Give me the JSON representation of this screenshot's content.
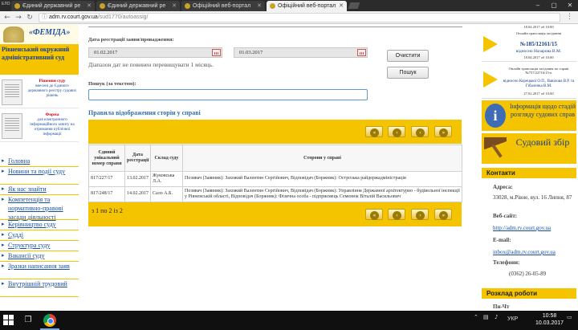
{
  "browser": {
    "profile_label": "ЕЛО",
    "tabs": [
      {
        "title": "Єдиний державний ре"
      },
      {
        "title": "Єдиний державний ре"
      },
      {
        "title": "Офіційний веб-портал"
      },
      {
        "title": "Офіційний веб-портал"
      }
    ],
    "url_host": "adm.rv.court.gov.ua",
    "url_path": "/sud1770/autoassig/"
  },
  "left": {
    "logo_text": "«ФЕМІДА»",
    "court_name": "Рівненський окружний адміністративний суд",
    "promo1_bold": "Рішення суду",
    "promo1_text": "внесені до Єдиного державного реєстру судових рішень",
    "promo2_bold": "Форма",
    "promo2_text": "для електронного інформаційного запиту на отримання публічної інформації",
    "nav": [
      "Головна",
      "Новини та події суду",
      "Як нас знайти",
      "Компетенція та нормативно-правові засади діяльності",
      "Керівництво суду",
      "Судді",
      "Структура суду",
      "Вакансії суду",
      "Зразки написання заяв",
      "Внутрішній трудовий"
    ]
  },
  "form": {
    "date_label": "Дата реєстрації заяви/провадження:",
    "date_from": "01.02.2017",
    "date_to": "01.03.2017",
    "note": "Діапазон дат не повинен перевищувати 1 місяць.",
    "search_label": "Пошук (за текстом):",
    "search_value": "",
    "clear_button": "Очистити",
    "search_button": "Пошук"
  },
  "results": {
    "section_title": "Правила відображення сторін у справі",
    "columns": [
      "Єдиний унікальний номер справи",
      "Дата реєстрації",
      "Склад суду",
      "Сторони у справі"
    ],
    "rows": [
      {
        "num": "817/227/17",
        "date": "13.02.2017",
        "judge": "Жуковська Л.А.",
        "parties": "Позивач (Заявник): Захожий Валентин Сергійович, Відповідач (Боржник): Острозька райдержадміністрація"
      },
      {
        "num": "817/248/17",
        "date": "14.02.2017",
        "judge": "Сало А.Б.",
        "parties": "Позивач (Заявник): Захожий Валентин Сергійович, Відповідач (Боржник): Управління Державної архітектурно - будівельної інспекції у Рівненській області, Відповідач (Боржник): Фізична особа - підприємець Семенюк Віталій Васильович"
      }
    ],
    "pager_info": "з 1 по 2 із 2",
    "pager_first": "«",
    "pager_prev": "‹",
    "pager_next": "›",
    "pager_last": "»"
  },
  "right": {
    "banner1_small": "Онлайн трансляція засідання",
    "banner1_num_top": "18.04.2017 об 10:00",
    "banner1_big": "№185/12161/15",
    "banner1_line": "відносно Назарова В.М.",
    "banner1_date": "18.04.2017 об 10:00",
    "banner2_small": "Онлайн трансляція засідання по справі №757/22716/15-к",
    "banner2_line": "відносно Корецької О.П., Вавілова В.Р. та Гібаленка В.М.",
    "banner2_date": "27.02.2017 об 10:00",
    "info_text": "Інформація щодо стадій розгляду судових справ",
    "fee_text": "Судовий збір",
    "contacts_header": "Контакти",
    "address_label": "Адреса:",
    "address_value": "33028, м.Рівне, вул. 16 Липня, 87",
    "website_label": "Веб-сайт:",
    "website_value": "http://adm.rv.court.gov.ua",
    "email_label": "E-mail:",
    "email_value": "inbox@adm.rv.court.gov.ua",
    "phone_label": "Телефони:",
    "phone_value": "(0362) 26-05-89",
    "schedule_header": "Розклад роботи",
    "schedule_first": "Пн-Чт"
  },
  "taskbar": {
    "lang": "УКР",
    "time": "10:58",
    "date": "10.03.2017"
  }
}
